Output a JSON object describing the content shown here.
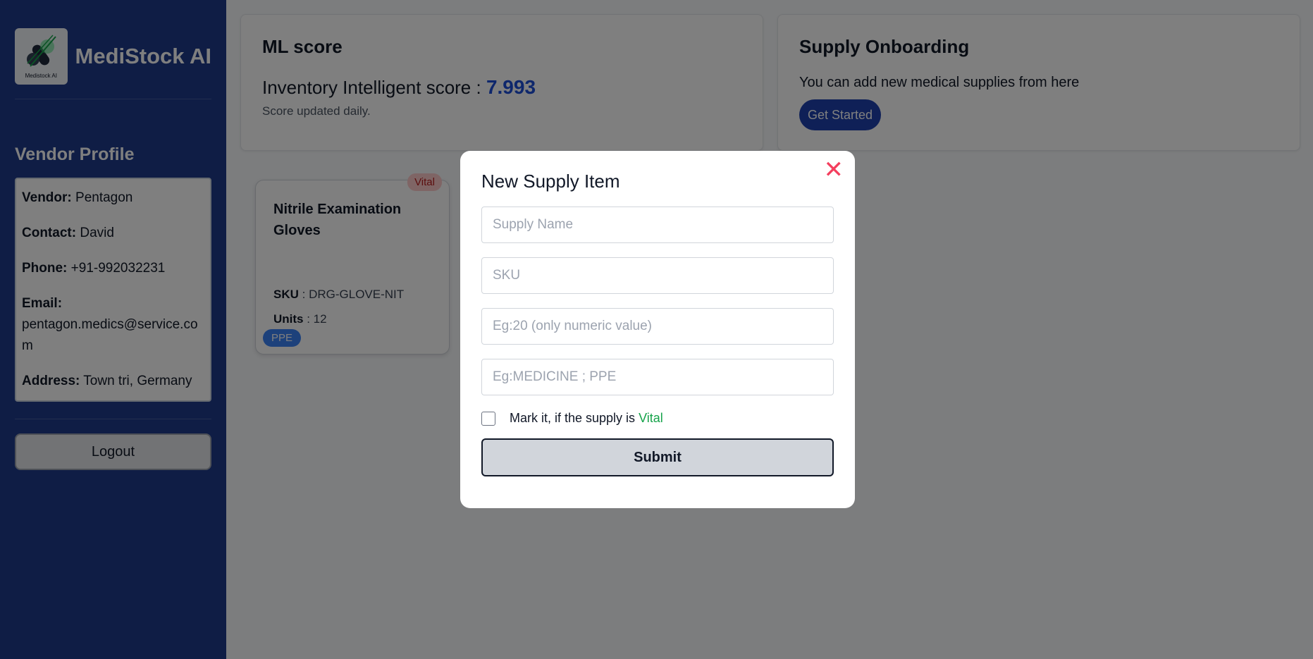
{
  "sidebar": {
    "brand_name": "MediStock AI",
    "logo_caption": "Medistock AI",
    "profile_heading": "Vendor Profile",
    "profile": {
      "vendor_label": "Vendor:",
      "vendor_value": "Pentagon",
      "contact_label": "Contact:",
      "contact_value": "David",
      "phone_label": "Phone:",
      "phone_value": "+91-992032231",
      "email_label": "Email:",
      "email_value": "pentagon.medics@service.com",
      "address_label": "Address:",
      "address_value": "Town tri, Germany"
    },
    "logout_label": "Logout"
  },
  "ml_card": {
    "title": "ML score",
    "score_label": "Inventory Intelligent score : ",
    "score_value": "7.993",
    "note": "Score updated daily."
  },
  "supply_card": {
    "title": "Supply Onboarding",
    "description": "You can add new medical supplies from here",
    "button_label": "Get Started"
  },
  "item": {
    "badge": "Vital",
    "name": "Nitrile Examination Gloves",
    "sku_label": "SKU",
    "sku_value": " : DRG-GLOVE-NIT",
    "units_label": "Units",
    "units_value": " : 12",
    "category": "PPE"
  },
  "modal": {
    "title": "New Supply Item",
    "close_icon": "close-icon",
    "supply_name_placeholder": "Supply Name",
    "sku_placeholder": "SKU",
    "units_placeholder": "Eg:20 (only numeric value)",
    "category_placeholder": "Eg:MEDICINE ; PPE",
    "vital_text": "Mark it, if the supply is ",
    "vital_word": "Vital",
    "submit_label": "Submit"
  },
  "colors": {
    "sidebar": "#1e3a8a",
    "accent": "#1d4ed8",
    "vital": "#16a34a",
    "close": "#f43f5e"
  }
}
